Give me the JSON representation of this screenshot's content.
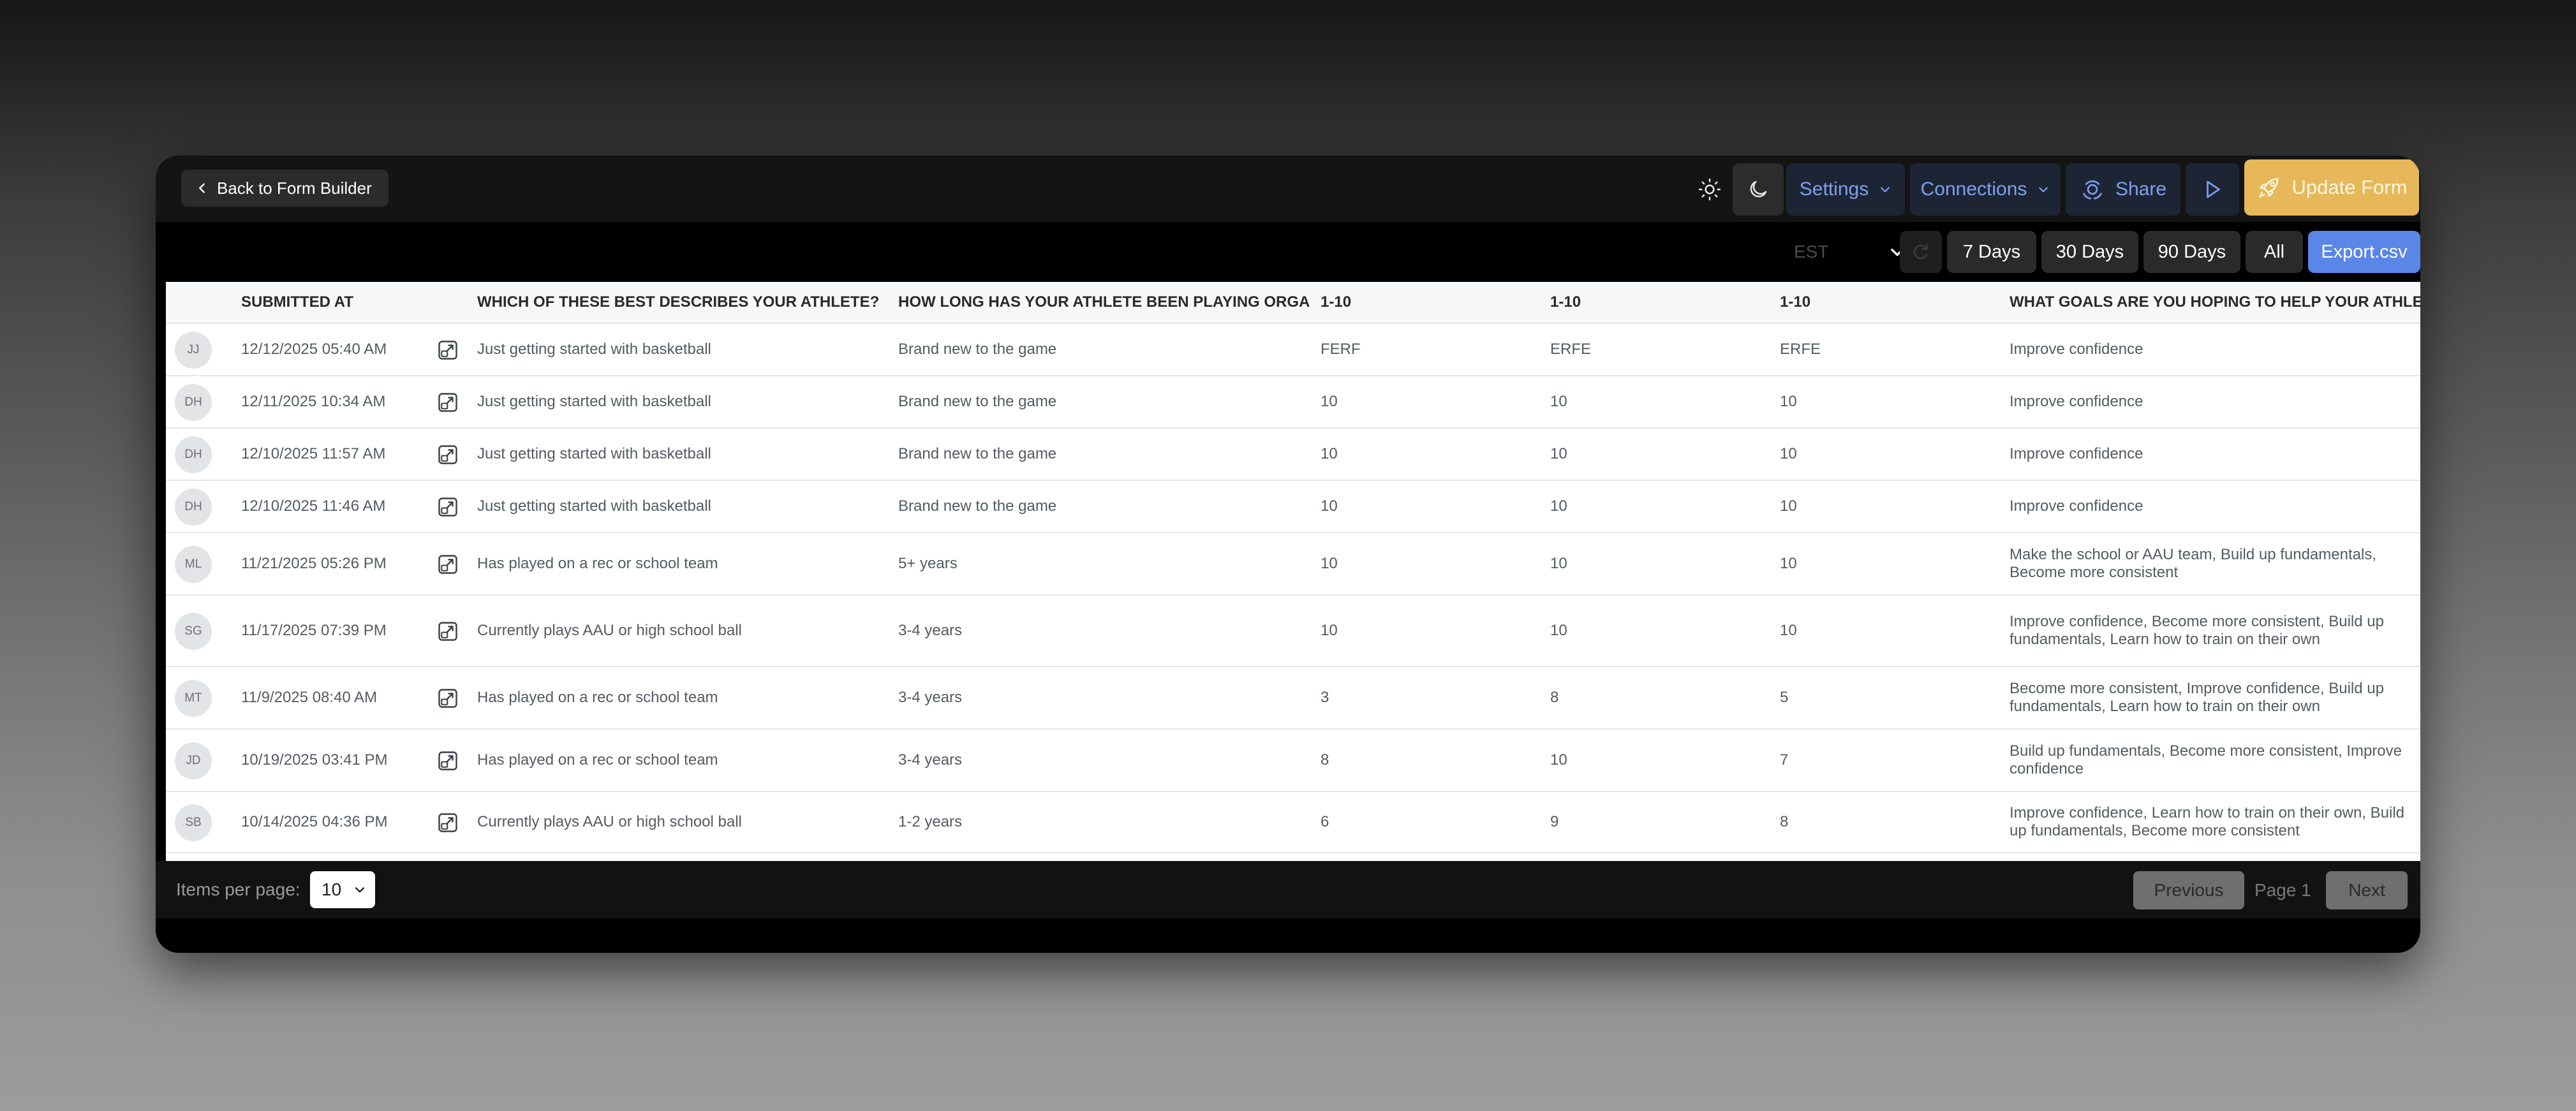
{
  "header": {
    "back_label": "Back to Form Builder",
    "settings_label": "Settings",
    "connections_label": "Connections",
    "share_label": "Share",
    "update_label": "Update Form"
  },
  "filters": {
    "timezone": "EST",
    "ranges": [
      "7 Days",
      "30 Days",
      "90 Days",
      "All"
    ],
    "export_label": "Export.csv"
  },
  "table": {
    "columns": [
      "",
      "SUBMITTED AT",
      "",
      "WHICH OF THESE BEST DESCRIBES YOUR ATHLETE?",
      "HOW LONG HAS YOUR ATHLETE BEEN PLAYING ORGANI",
      "1-10",
      "1-10",
      "1-10",
      "WHAT GOALS ARE YOU HOPING TO HELP YOUR ATHLETE"
    ],
    "rows": [
      {
        "initials": "JJ",
        "submitted": "12/12/2025 05:40 AM",
        "describes": "Just getting started with basketball",
        "how_long": "Brand new to the game",
        "r1": "FERF",
        "r2": "ERFE",
        "r3": "ERFE",
        "goals": "Improve confidence"
      },
      {
        "initials": "DH",
        "submitted": "12/11/2025 10:34 AM",
        "describes": "Just getting started with basketball",
        "how_long": "Brand new to the game",
        "r1": "10",
        "r2": "10",
        "r3": "10",
        "goals": "Improve confidence"
      },
      {
        "initials": "DH",
        "submitted": "12/10/2025 11:57 AM",
        "describes": "Just getting started with basketball",
        "how_long": "Brand new to the game",
        "r1": "10",
        "r2": "10",
        "r3": "10",
        "goals": "Improve confidence"
      },
      {
        "initials": "DH",
        "submitted": "12/10/2025 11:46 AM",
        "describes": "Just getting started with basketball",
        "how_long": "Brand new to the game",
        "r1": "10",
        "r2": "10",
        "r3": "10",
        "goals": "Improve confidence"
      },
      {
        "initials": "ML",
        "submitted": "11/21/2025 05:26 PM",
        "describes": "Has played on a rec or school team",
        "how_long": "5+ years",
        "r1": "10",
        "r2": "10",
        "r3": "10",
        "goals": "Make the school or AAU team, Build up fundamentals, Become more consistent"
      },
      {
        "initials": "SG",
        "submitted": "11/17/2025 07:39 PM",
        "describes": "Currently plays AAU or high school ball",
        "how_long": "3-4 years",
        "r1": "10",
        "r2": "10",
        "r3": "10",
        "goals": "Improve confidence, Become more consistent, Build up fundamentals, Learn how to train on their own"
      },
      {
        "initials": "MT",
        "submitted": "11/9/2025 08:40 AM",
        "describes": "Has played on a rec or school team",
        "how_long": "3-4 years",
        "r1": "3",
        "r2": "8",
        "r3": "5",
        "goals": "Become more consistent, Improve confidence, Build up fundamentals, Learn how to train on their own"
      },
      {
        "initials": "JD",
        "submitted": "10/19/2025 03:41 PM",
        "describes": "Has played on a rec or school team",
        "how_long": "3-4 years",
        "r1": "8",
        "r2": "10",
        "r3": "7",
        "goals": "Build up fundamentals, Become more consistent, Improve confidence"
      },
      {
        "initials": "SB",
        "submitted": "10/14/2025 04:36 PM",
        "describes": "Currently plays AAU or high school ball",
        "how_long": "1-2 years",
        "r1": "6",
        "r2": "9",
        "r3": "8",
        "goals": "Improve confidence, Learn how to train on their own, Build up fundamentals, Become more consistent"
      }
    ]
  },
  "pagination": {
    "items_per_page_label": "Items per page:",
    "items_per_page": "10",
    "previous_label": "Previous",
    "page_label": "Page 1",
    "next_label": "Next"
  }
}
